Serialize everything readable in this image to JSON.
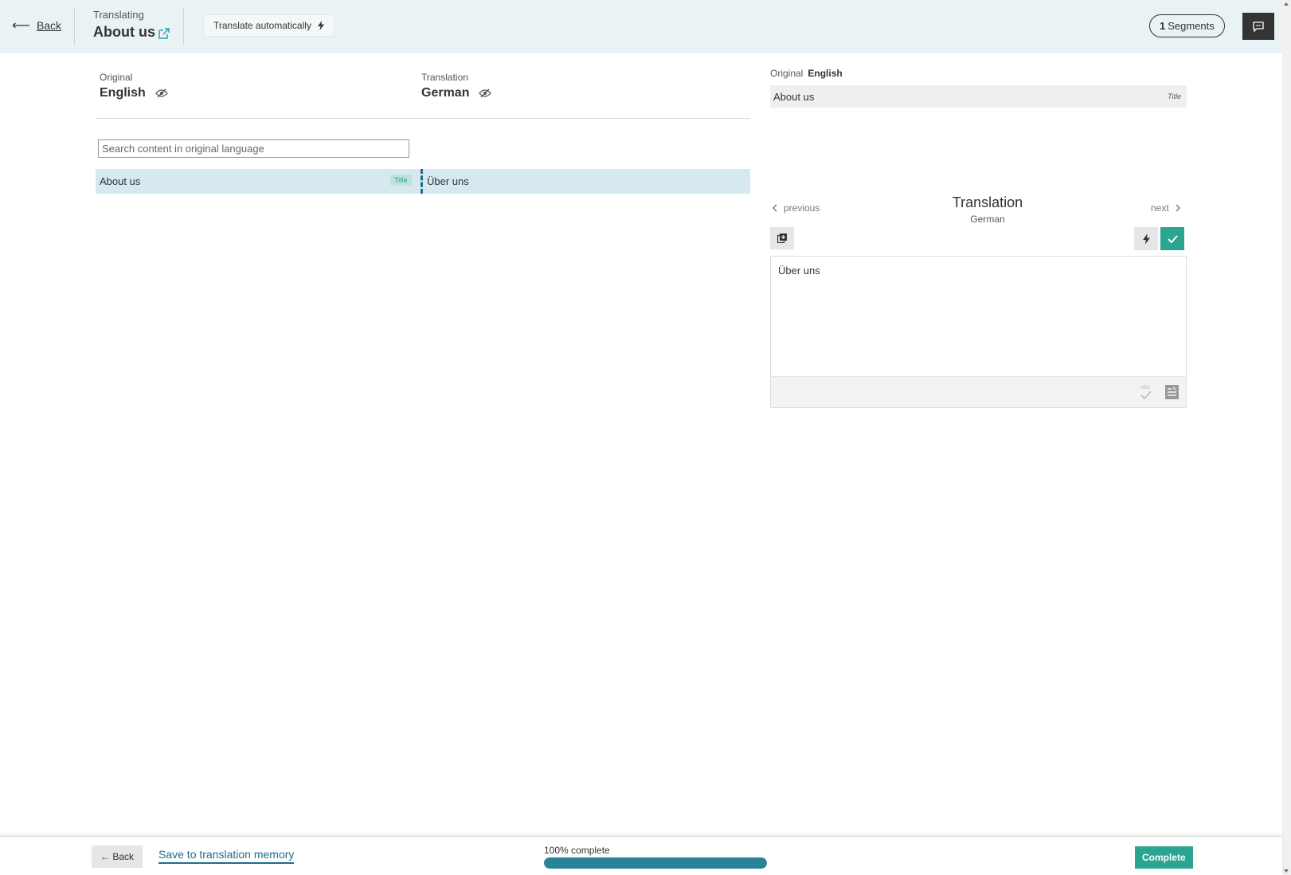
{
  "header": {
    "back_label": "Back",
    "translating_label": "Translating",
    "page_title": "About us",
    "translate_auto_label": "Translate automatically",
    "segments_count": "1",
    "segments_label": "Segments"
  },
  "languages": {
    "original_label": "Original",
    "original_lang": "English",
    "translation_label": "Translation",
    "translation_lang": "German"
  },
  "search": {
    "placeholder": "Search content in original language"
  },
  "segments": [
    {
      "original": "About us",
      "type": "Title",
      "translation": "Über uns"
    }
  ],
  "panel": {
    "original_label": "Original",
    "original_lang": "English",
    "original_text": "About us",
    "original_tag": "Title",
    "prev_label": "previous",
    "next_label": "next",
    "title": "Translation",
    "subtitle": "German",
    "editor_text": "Über uns"
  },
  "footer": {
    "back_label": "← Back",
    "save_label": "Save to translation memory",
    "progress_label": "100% complete",
    "progress_fraction": 1.0,
    "complete_label": "Complete"
  },
  "colors": {
    "accent": "#2ba58f",
    "progress": "#2a8298",
    "header_bg": "#e9f3f5",
    "selected_row": "#d6e8f0"
  }
}
